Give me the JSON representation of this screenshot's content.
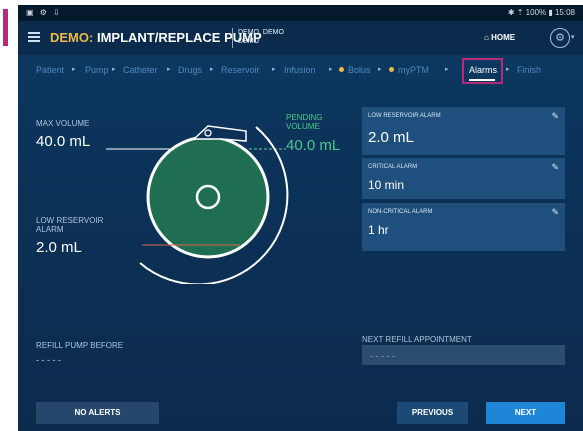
{
  "status_bar": {
    "left_icons": "▣ ⚙ ⇩",
    "right": "✱ ⇡ 100% ▮ 15:08"
  },
  "app_bar": {
    "title_prefix": "DEMO:",
    "title": "IMPLANT/REPLACE PUMP",
    "patient_line1": "DEMO, DEMO",
    "patient_line2": "DEMO",
    "home_label": "HOME",
    "home_icon": "⌂",
    "gear_icon": "⚙",
    "caret": "▾"
  },
  "nav": {
    "arrow": "▸",
    "items": [
      {
        "label": "Patient"
      },
      {
        "label": "Pump"
      },
      {
        "label": "Catheter"
      },
      {
        "label": "Drugs"
      },
      {
        "label": "Reservoir"
      },
      {
        "label": "Infusion"
      },
      {
        "label": "Bolus"
      },
      {
        "label": "myPTM"
      },
      {
        "label": "Alarms"
      },
      {
        "label": "Finish"
      }
    ],
    "active": "Alarms"
  },
  "diagram": {
    "max_volume_label": "MAX VOLUME",
    "max_volume_value": "40.0 mL",
    "pending_volume_label_1": "PENDING",
    "pending_volume_label_2": "VOLUME",
    "pending_volume_value": "40.0 mL",
    "low_reservoir_label_1": "LOW RESERVOIR",
    "low_reservoir_label_2": "ALARM",
    "low_reservoir_value": "2.0 mL"
  },
  "alarm_cards": [
    {
      "label": "LOW RESERVOIR ALARM",
      "value": "2.0 mL"
    },
    {
      "label": "CRITICAL ALARM",
      "value": "10 min"
    },
    {
      "label": "NON-CRITICAL ALARM",
      "value": "1 hr"
    }
  ],
  "edit_icon": "✎",
  "refill": {
    "before_label": "REFILL PUMP BEFORE",
    "before_value": "- - - - -",
    "appointment_label": "NEXT REFILL APPOINTMENT",
    "appointment_value": "- - - - -"
  },
  "buttons": {
    "no_alerts": "NO ALERTS",
    "previous": "PREVIOUS",
    "next": "NEXT"
  },
  "colors": {
    "accent_orange": "#f0b84a",
    "highlight_magenta": "#b8297a",
    "pending_green": "#49c88a",
    "primary_blue": "#1e86d6"
  }
}
